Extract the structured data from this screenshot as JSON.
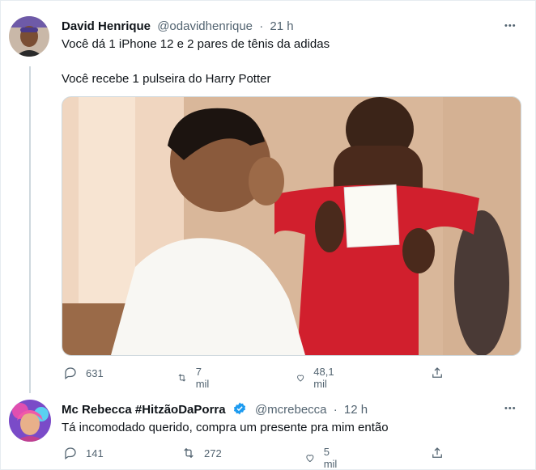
{
  "tweet1": {
    "author_name": "David Henrique",
    "handle": "@odavidhenrique",
    "separator": "·",
    "time": "21 h",
    "more_label": "•••",
    "line1": "Você dá 1 iPhone 12 e 2 pares de tênis da adidas",
    "line2": "Você recebe 1 pulseira do Harry Potter",
    "reply_count": "631",
    "retweet_count": "7 mil",
    "like_count": "48,1 mil"
  },
  "tweet2": {
    "author_name": "Mc Rebecca #HitzãoDaPorra",
    "handle": "@mcrebecca",
    "separator": "·",
    "time": "12 h",
    "more_label": "•••",
    "text": "Tá incomodado querido, compra um presente pra mim então",
    "reply_count": "141",
    "retweet_count": "272",
    "like_count": "5 mil"
  },
  "colors": {
    "secondary": "#536471",
    "verified": "#1d9bf0",
    "line": "#cfd9de"
  }
}
